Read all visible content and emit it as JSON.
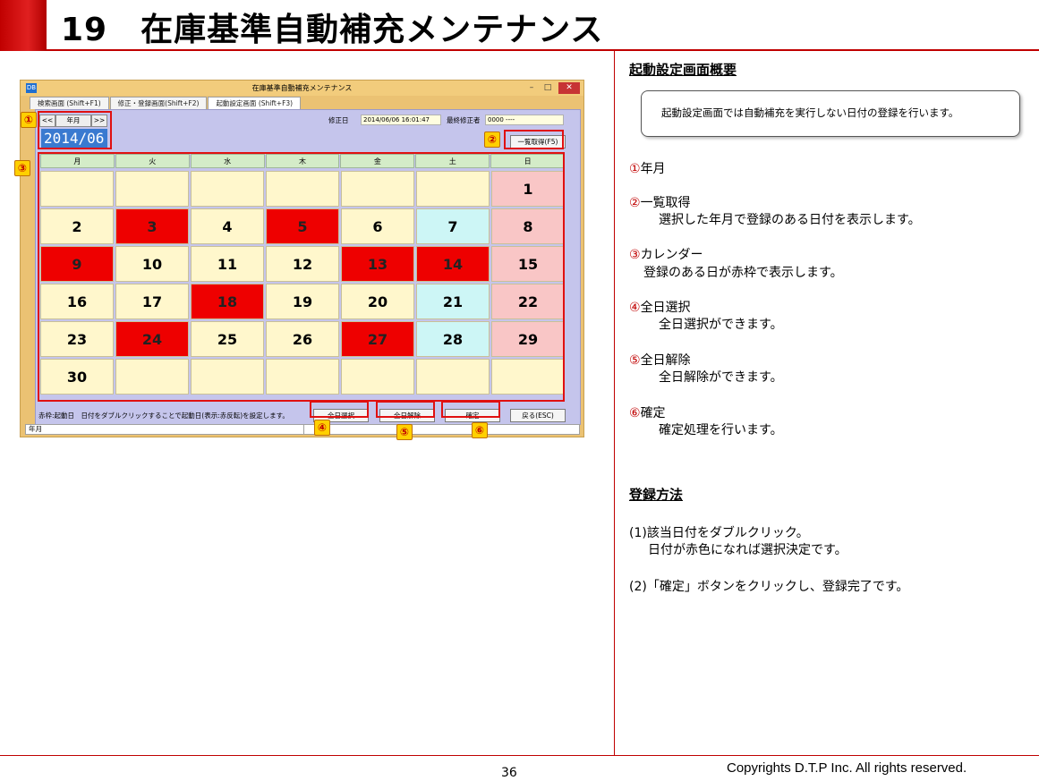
{
  "header": {
    "title": "19　在庫基準自動補充メンテナンス"
  },
  "footer": {
    "page_number": "36",
    "copyright": "Copyrights  D.T.P Inc. All rights reserved."
  },
  "window": {
    "title": "在庫基準自動補充メンテナンス",
    "tabs": [
      "検索画面 (Shift+F1)",
      "修正・登録画面(Shift+F2)",
      "起動設定画面 (Shift+F3)"
    ],
    "nav": {
      "prev": "<<",
      "month": "年月",
      "next": ">>"
    },
    "year_month": "2014/06",
    "modified_label": "修正日",
    "modified_value": "2014/06/06 16:01:47",
    "last_editor_label": "最終修正者",
    "last_editor_value": "0000 ----",
    "fetch_button": "一覧取得(F5)",
    "weekdays": [
      "月",
      "火",
      "水",
      "木",
      "金",
      "土",
      "日"
    ],
    "calendar_rows": [
      [
        "",
        "",
        "",
        "",
        "",
        "",
        "1"
      ],
      [
        "2",
        "3",
        "4",
        "5",
        "6",
        "7",
        "8"
      ],
      [
        "9",
        "10",
        "11",
        "12",
        "13",
        "14",
        "15"
      ],
      [
        "16",
        "17",
        "18",
        "19",
        "20",
        "21",
        "22"
      ],
      [
        "23",
        "24",
        "25",
        "26",
        "27",
        "28",
        "29"
      ],
      [
        "30",
        "",
        "",
        "",
        "",
        "",
        ""
      ]
    ],
    "registered_days": [
      "3",
      "5",
      "9",
      "13",
      "14",
      "18",
      "24",
      "27"
    ],
    "status_text": "赤枠:起動日　日付をダブルクリックすることで起動日(表示:赤反転)を設定します。",
    "buttons": {
      "select_all": "全日選択",
      "clear_all": "全日解除",
      "confirm": "確定",
      "back": "戻る(ESC)"
    },
    "statusbar": "年月"
  },
  "callouts": [
    "①",
    "②",
    "③",
    "④",
    "⑤",
    "⑥"
  ],
  "right_panel": {
    "section1_title": "起動設定画面概要",
    "summary": "起動設定画面では自動補充を実行しない日付の登録を行います。",
    "items": [
      {
        "num": "①",
        "label": "年月",
        "desc": ""
      },
      {
        "num": "②",
        "label": "一覧取得",
        "desc": "選択した年月で登録のある日付を表示します。"
      },
      {
        "num": "③",
        "label": "カレンダー",
        "desc": "登録のある日が赤枠で表示します。"
      },
      {
        "num": "④",
        "label": "全日選択",
        "desc": "全日選択ができます。"
      },
      {
        "num": "⑤",
        "label": "全日解除",
        "desc": "全日解除ができます。"
      },
      {
        "num": "⑥",
        "label": "確定",
        "desc": "確定処理を行います。"
      }
    ],
    "section2_title": "登録方法",
    "steps": [
      {
        "line1": "(1)該当日付をダブルクリック。",
        "line2": "日付が赤色になれば選択決定です。"
      },
      {
        "line1": "(2)「確定」ボタンをクリックし、登録完了です。",
        "line2": ""
      }
    ]
  }
}
